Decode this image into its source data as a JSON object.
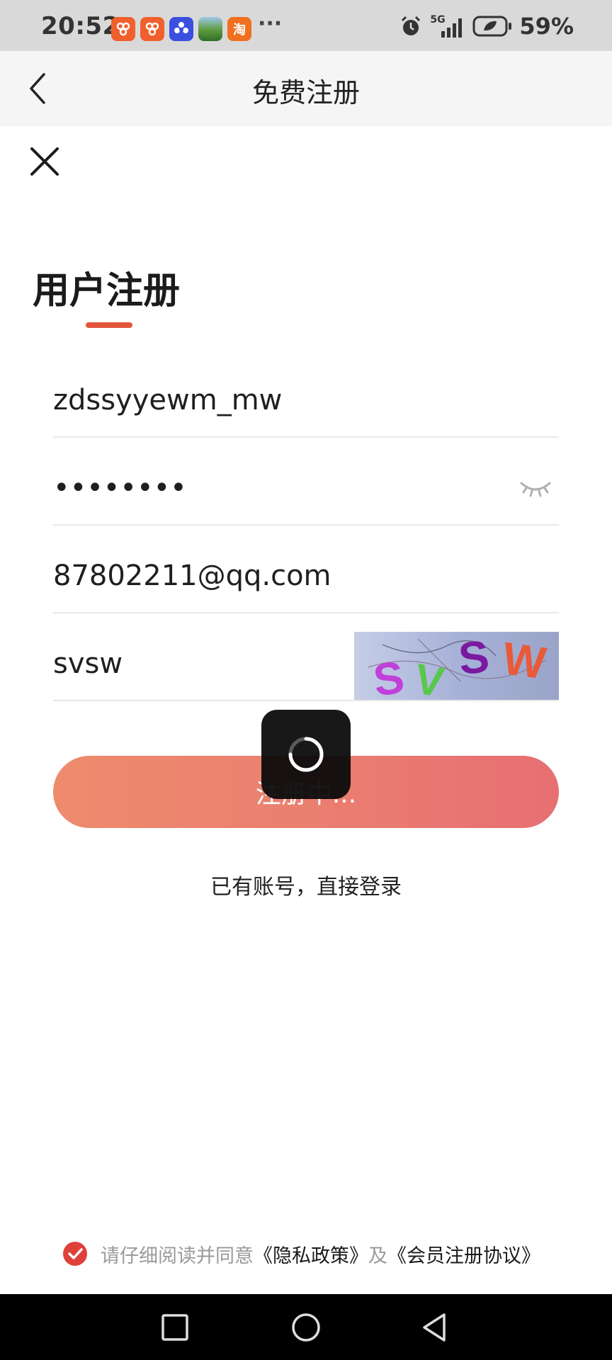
{
  "status_bar": {
    "time": "20:52",
    "app_icons": [
      {
        "name": "app-icon-1",
        "glyph": "8",
        "color": "#f0602c"
      },
      {
        "name": "app-icon-2",
        "glyph": "8",
        "color": "#f0602c"
      },
      {
        "name": "app-icon-3",
        "glyph": "❀",
        "color": "#3a4fe0"
      },
      {
        "name": "app-icon-4",
        "glyph": "",
        "color": "#4a8a3a"
      },
      {
        "name": "app-icon-5",
        "glyph": "淘",
        "color": "#f07020"
      }
    ],
    "more": "···",
    "network": "5G",
    "battery": "59%"
  },
  "header": {
    "title": "免费注册"
  },
  "form": {
    "heading": "用户注册",
    "username_value": "zdssyyewm_mw",
    "password_value": "••••••••",
    "email_value": "87802211@qq.com",
    "captcha_value": "svsw",
    "captcha_image_text": [
      "S",
      "V",
      "S",
      "W"
    ],
    "register_label": "注册中..."
  },
  "login_link": "已有账号，直接登录",
  "agreement": {
    "prefix": "请仔细阅读并同意",
    "privacy": "《隐私政策》",
    "and": "及",
    "terms": "《会员注册协议》"
  },
  "colors": {
    "accent": "#e2573a",
    "button_start": "#ee8b6d",
    "button_end": "#e76f73",
    "check": "#e0403a"
  }
}
